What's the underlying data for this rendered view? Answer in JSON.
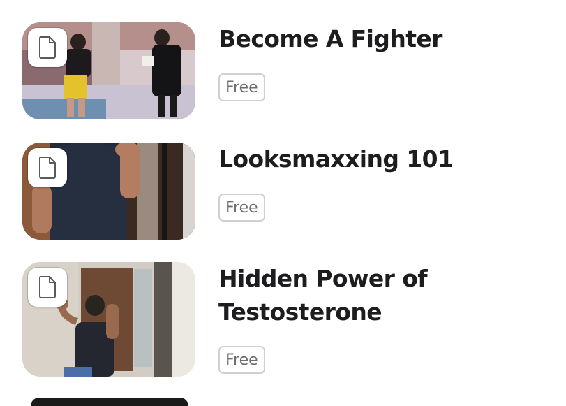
{
  "courses": [
    {
      "title": "Become A Fighter",
      "price": "Free",
      "thumbnail_icon": "document-icon"
    },
    {
      "title": "Looksmaxxing 101",
      "price": "Free",
      "thumbnail_icon": "document-icon"
    },
    {
      "title_lines": [
        "Hidden Power of",
        "Testosterone"
      ],
      "price": "Free",
      "thumbnail_icon": "document-icon"
    }
  ]
}
